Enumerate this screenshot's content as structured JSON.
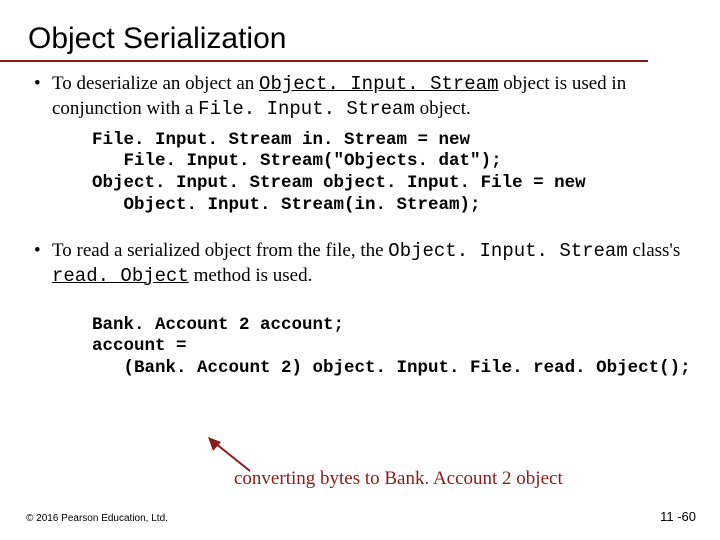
{
  "title": "Object Serialization",
  "bullets": {
    "b1": {
      "pre": "To deserialize an object an ",
      "code1": "Object. Input. Stream",
      "mid": " object is used in conjunction with a ",
      "code2": "File. Input. Stream",
      "post": " object."
    },
    "b2": {
      "pre": "To read a serialized object from the file, the ",
      "code1": "Object. Input. Stream",
      "mid": " class's ",
      "code2": "read. Object",
      "post": " method is used."
    }
  },
  "code1": "File. Input. Stream in. Stream = new\n   File. Input. Stream(\"Objects. dat\");\nObject. Input. Stream object. Input. File = new\n   Object. Input. Stream(in. Stream);",
  "code2": "Bank. Account 2 account;\naccount =\n   (Bank. Account 2) object. Input. File. read. Object();",
  "caption": "converting bytes to Bank. Account 2 object",
  "footer": {
    "left": "© 2016 Pearson Education, Ltd.",
    "right": "11 -60"
  }
}
